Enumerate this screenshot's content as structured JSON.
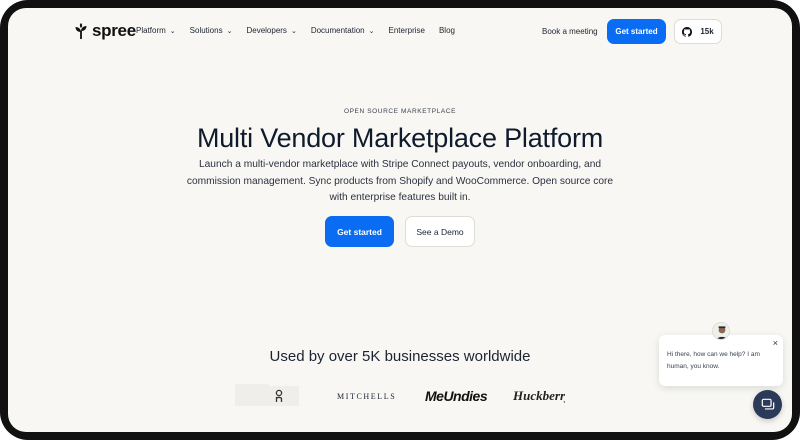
{
  "brand": {
    "name": "spree"
  },
  "nav": {
    "items": [
      {
        "label": "Platform",
        "has_dropdown": true
      },
      {
        "label": "Solutions",
        "has_dropdown": true
      },
      {
        "label": "Developers",
        "has_dropdown": true
      },
      {
        "label": "Documentation",
        "has_dropdown": true
      },
      {
        "label": "Enterprise",
        "has_dropdown": false
      },
      {
        "label": "Blog",
        "has_dropdown": false
      }
    ],
    "book_meeting": "Book a meeting",
    "get_started": "Get started",
    "github_stars": "15k"
  },
  "hero": {
    "eyebrow": "OPEN SOURCE MARKETPLACE",
    "title": "Multi Vendor Marketplace Platform",
    "subtitle": "Launch a multi-vendor marketplace with Stripe Connect payouts, vendor onboarding, and commission management. Sync products from Shopify and WooCommerce. Open source core with enterprise features built in.",
    "primary_cta": "Get started",
    "secondary_cta": "See a Demo"
  },
  "social_proof": {
    "heading": "Used by over 5K businesses worldwide",
    "logos": [
      "On",
      "MITCHELLS",
      "MeUndies",
      "Huckberry"
    ]
  },
  "chat": {
    "message": "Hi there, how can we help? I am human, you know.",
    "close": "×"
  },
  "colors": {
    "accent": "#0a6cf2",
    "background": "#f8f7f3",
    "chat_launcher": "#2a3a58"
  }
}
